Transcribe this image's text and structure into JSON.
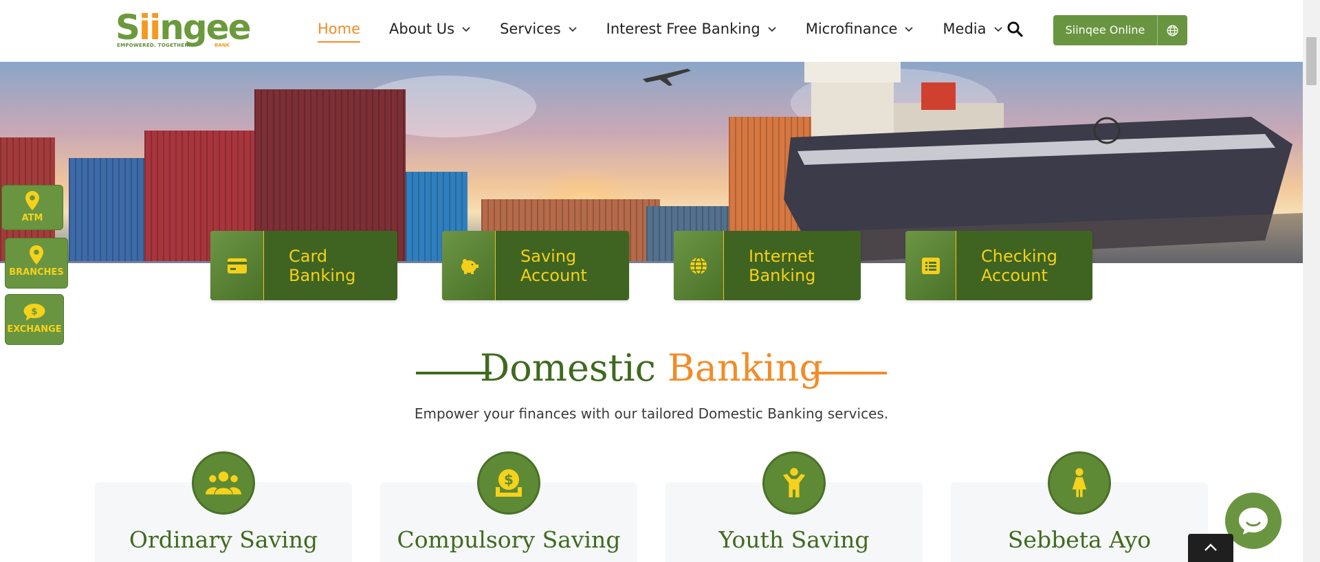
{
  "brand": {
    "name": "Siingee",
    "name_prefix": "S",
    "name_accent": "ii",
    "name_suffix": "ngee",
    "tagline": "EMPOWERED. TOGETHER.",
    "bank_word": "BANK",
    "colors": {
      "green": "#6a9540",
      "dark_green": "#3f6421",
      "orange": "#f28c28",
      "yellow": "#f4d01a"
    }
  },
  "nav": {
    "items": [
      {
        "label": "Home",
        "active": true,
        "has_dropdown": false
      },
      {
        "label": "About Us",
        "active": false,
        "has_dropdown": true
      },
      {
        "label": "Services",
        "active": false,
        "has_dropdown": true
      },
      {
        "label": "Interest Free Banking",
        "active": false,
        "has_dropdown": true
      },
      {
        "label": "Microfinance",
        "active": false,
        "has_dropdown": true
      },
      {
        "label": "Media",
        "active": false,
        "has_dropdown": true
      }
    ],
    "search_icon": "search-icon",
    "online_button": {
      "label": "Siinqee Online",
      "icon": "globe-icon"
    }
  },
  "side_widgets": [
    {
      "label": "ATM",
      "icon": "map-pin-icon"
    },
    {
      "label": "BRANCHES",
      "icon": "map-pin-icon"
    },
    {
      "label": "EXCHANGE",
      "icon": "dollar-chat-icon"
    }
  ],
  "quick_links": [
    {
      "line1": "Card",
      "line2": "Banking",
      "icon": "credit-card-icon"
    },
    {
      "line1": "Saving",
      "line2": "Account",
      "icon": "piggy-bank-icon"
    },
    {
      "line1": "Internet",
      "line2": "Banking",
      "icon": "globe-icon"
    },
    {
      "line1": "Checking",
      "line2": "Account",
      "icon": "list-icon"
    }
  ],
  "section": {
    "title_part1": "Domestic",
    "title_part2": "Banking",
    "subtitle": "Empower your finances with our tailored Domestic Banking services."
  },
  "cards": [
    {
      "title": "Ordinary Saving",
      "icon": "users-icon"
    },
    {
      "title": "Compulsory Saving",
      "icon": "money-deposit-icon"
    },
    {
      "title": "Youth Saving",
      "icon": "child-icon"
    },
    {
      "title": "Sebbeta Ayo",
      "icon": "woman-icon"
    }
  ],
  "widgets": {
    "chat_icon": "chat-icon",
    "back_to_top_icon": "chevron-up-icon"
  }
}
